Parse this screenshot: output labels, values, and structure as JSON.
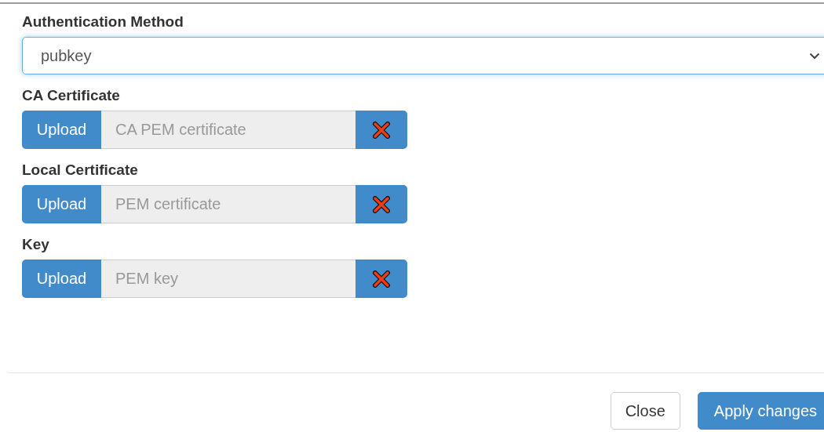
{
  "auth_method": {
    "label": "Authentication Method",
    "value": "pubkey"
  },
  "uploads": [
    {
      "label": "CA Certificate",
      "button": "Upload",
      "placeholder": "CA PEM certificate"
    },
    {
      "label": "Local Certificate",
      "button": "Upload",
      "placeholder": "PEM certificate"
    },
    {
      "label": "Key",
      "button": "Upload",
      "placeholder": "PEM key"
    }
  ],
  "footer_buttons": [
    {
      "label": "Close",
      "kind": "default"
    },
    {
      "label": "Apply changes",
      "kind": "primary"
    }
  ]
}
